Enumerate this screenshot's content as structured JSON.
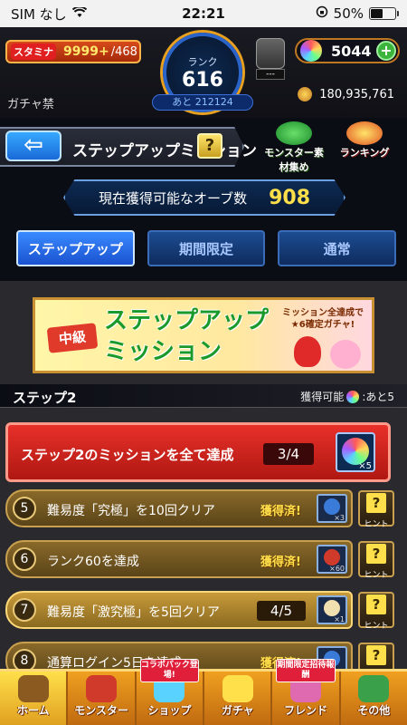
{
  "status_bar": {
    "carrier": "SIM なし",
    "time": "22:21",
    "battery": "50%",
    "battery_level": 0.5
  },
  "hud": {
    "stamina_label": "スタミナ",
    "stamina_value": "9999+",
    "stamina_max": "/468",
    "rank_label": "ランク",
    "rank_value": "616",
    "next_rank": "あと 212124",
    "gift_label": "---",
    "orb_count": "5044",
    "gacha_ban": "ガチャ禁",
    "coins": "180,935,761"
  },
  "title_bar": {
    "back_label": "⇦",
    "title": "ステップアップミッション",
    "help_label": "?",
    "monster_btn": "モンスター素材集め",
    "ranking_btn": "ランキング"
  },
  "orb_panel": {
    "label": "現在獲得可能なオーブ数",
    "value": "908"
  },
  "tabs": [
    {
      "label": "ステップアップ",
      "active": true
    },
    {
      "label": "期間限定",
      "active": false
    },
    {
      "label": "通常",
      "active": false
    }
  ],
  "banner": {
    "level": "中級",
    "title_line1": "ステップアップ",
    "title_line2": "ミッション",
    "subtitle": "ミッション全達成で★6確定ガチャ!"
  },
  "step": {
    "label": "ステップ2",
    "reward_prefix": "獲得可能",
    "reward_suffix": ":あと5"
  },
  "main_mission": {
    "text": "ステップ2のミッションを全て達成",
    "progress": "3/4",
    "reward_qty": "×5"
  },
  "missions": [
    {
      "num": "5",
      "text": "難易度「究極」を10回クリア",
      "status": "獲得済!",
      "progress": "",
      "reward_qty": "×3",
      "item_color": "#3a7ad8",
      "hint": "ヒント"
    },
    {
      "num": "6",
      "text": "ランク60を達成",
      "status": "獲得済!",
      "progress": "",
      "reward_qty": "×60",
      "item_color": "#d03a2a",
      "hint": "ヒント"
    },
    {
      "num": "7",
      "text": "難易度「激究極」を5回クリア",
      "status": "",
      "progress": "4/5",
      "reward_qty": "×1",
      "item_color": "#f0e0b0",
      "hint": "ヒント"
    },
    {
      "num": "8",
      "text": "通算ログイン5日を達成",
      "status": "獲得済!",
      "progress": "",
      "reward_qty": "",
      "item_color": "#3a7ad8",
      "hint": "ヒント"
    }
  ],
  "bottom_nav": [
    {
      "label": "ホーム",
      "badge": "",
      "active": true
    },
    {
      "label": "モンスター",
      "badge": "",
      "active": false
    },
    {
      "label": "ショップ",
      "badge": "コラボパック登場!",
      "active": false
    },
    {
      "label": "ガチャ",
      "badge": "",
      "active": false
    },
    {
      "label": "フレンド",
      "badge": "期間限定招待報酬",
      "active": false
    },
    {
      "label": "その他",
      "badge": "",
      "active": false
    }
  ]
}
